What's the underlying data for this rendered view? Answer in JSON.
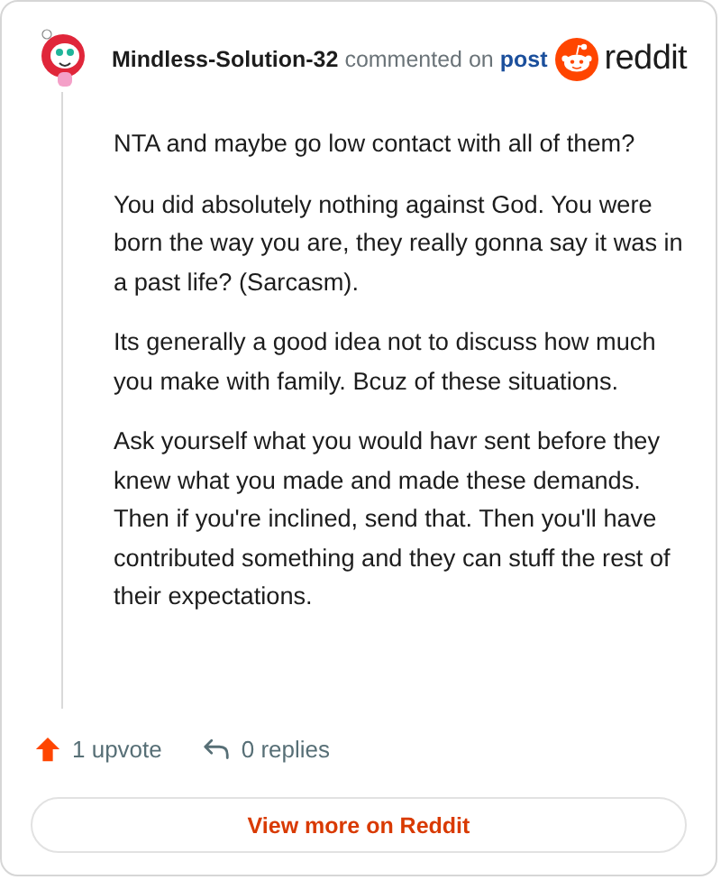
{
  "comment": {
    "author": "Mindless-Solution-32",
    "action": "commented on",
    "link": "post",
    "brand": "reddit",
    "paragraphs": [
      "NTA and maybe go low contact with all of them?",
      "You did absolutely nothing against God. You were born the way you are, they really gonna say it was in a past life? (Sarcasm).",
      "Its generally a good idea not to discuss how much you make with family. Bcuz of these situations.",
      "Ask yourself what you would havr sent before they knew what you made and made these demands. Then if you're inclined, send that. Then you'll have contributed something and they can stuff the rest of their expectations."
    ],
    "upvotes": "1 upvote",
    "replies": "0 replies"
  },
  "button": "View more on Reddit"
}
